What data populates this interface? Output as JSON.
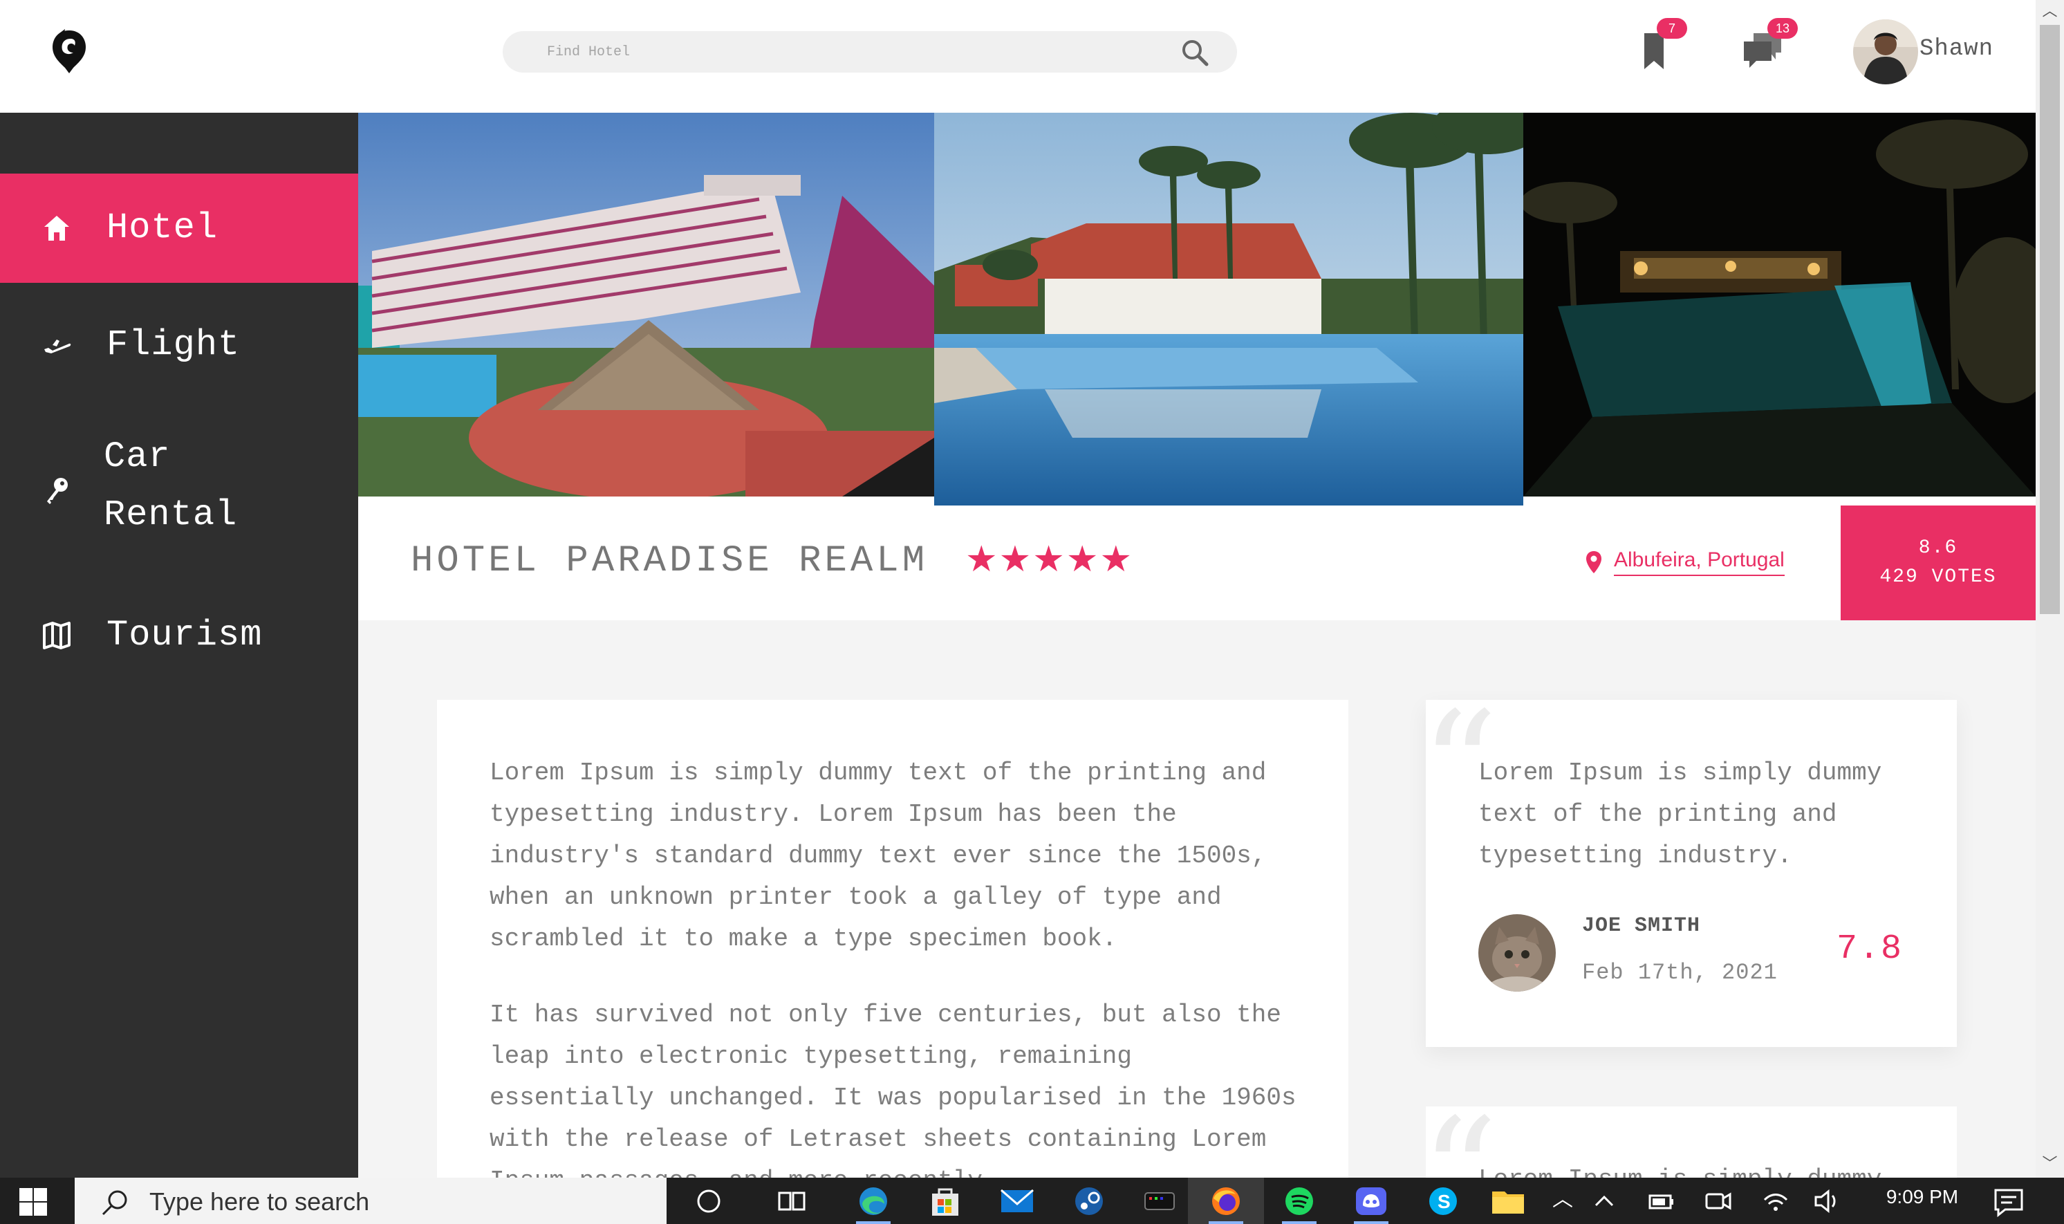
{
  "header": {
    "search_placeholder": "Find Hotel",
    "bookmarks_badge": "7",
    "messages_badge": "13",
    "user_name": "Shawn"
  },
  "sidebar": {
    "items": [
      {
        "label": "Hotel",
        "icon": "home-icon",
        "active": true
      },
      {
        "label": "Flight",
        "icon": "airplane-icon",
        "active": false
      },
      {
        "label": "Car",
        "label2": "Rental",
        "icon": "key-icon",
        "active": false
      },
      {
        "label": "Tourism",
        "icon": "map-icon",
        "active": false
      }
    ]
  },
  "hotel": {
    "title": "HOTEL PARADISE REALM",
    "stars": "★★★★★",
    "location": "Albufeira, Portugal",
    "rating": "8.6",
    "votes": "429 VOTES"
  },
  "description": {
    "p1": "Lorem Ipsum is simply dummy text of the printing and typesetting industry. Lorem Ipsum has been the industry's standard dummy text ever since the 1500s, when an unknown printer took a galley of type and scrambled it to make a type specimen book.",
    "p2": "It has survived not only five centuries, but also the leap into electronic typesetting, remaining essentially unchanged. It was popularised in the 1960s with the release of Letraset sheets containing Lorem Ipsum passages, and more recently"
  },
  "reviews": [
    {
      "text": "Lorem Ipsum is simply dummy text of the printing and typesetting industry.",
      "name": "JOE SMITH",
      "date": "Feb 17th, 2021",
      "score": "7.8"
    },
    {
      "text": "Lorem Ipsum is simply dummy"
    }
  ],
  "taskbar": {
    "search_text": "Type here to search",
    "time": "9:09 PM"
  },
  "colors": {
    "accent": "#e92f64",
    "sidebar": "#2f2f2f",
    "background": "#f4f4f4"
  }
}
